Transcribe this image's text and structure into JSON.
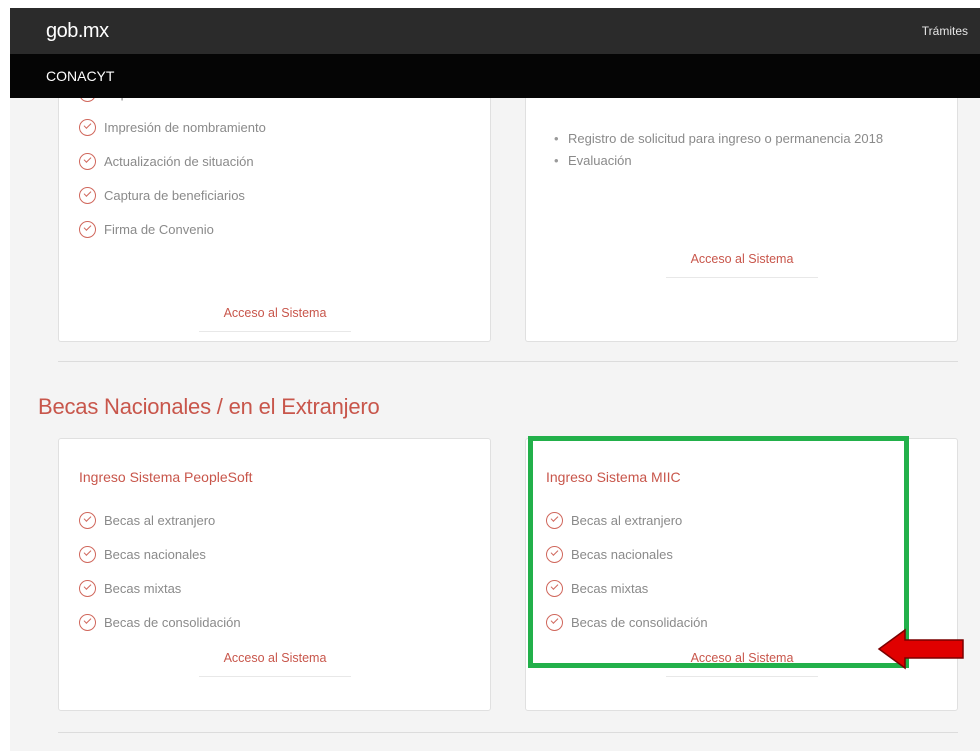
{
  "header": {
    "brand": "gob.mx",
    "nav_link": "Trámites",
    "subtitle": "CONACYT"
  },
  "top_cards": {
    "left": {
      "items": [
        "Captura de cuenta bancaria",
        "Impresión de nombramiento",
        "Actualización de situación",
        "Captura de beneficiarios",
        "Firma de Convenio"
      ],
      "access_label": "Acceso al Sistema"
    },
    "right": {
      "bullets": [
        "Registro de solicitud para ingreso o permanencia 2018",
        "Evaluación"
      ],
      "access_label": "Acceso al Sistema"
    }
  },
  "section": {
    "title": "Becas Nacionales / en el Extranjero"
  },
  "bottom_cards": {
    "left": {
      "title": "Ingreso Sistema PeopleSoft",
      "items": [
        "Becas al extranjero",
        "Becas nacionales",
        "Becas mixtas",
        "Becas de consolidación"
      ],
      "access_label": "Acceso al Sistema"
    },
    "right": {
      "title": "Ingreso Sistema MIIC",
      "items": [
        "Becas al extranjero",
        "Becas nacionales",
        "Becas mixtas",
        "Becas de consolidación"
      ],
      "access_label": "Acceso al Sistema"
    }
  },
  "colors": {
    "accent": "#c8564b",
    "highlight": "#22b04a",
    "arrow": "#e00000",
    "topbar": "#2b2b2b",
    "subbar": "#050505"
  },
  "icons": {
    "check": "check-circle-icon",
    "arrow": "arrow-left-icon"
  }
}
